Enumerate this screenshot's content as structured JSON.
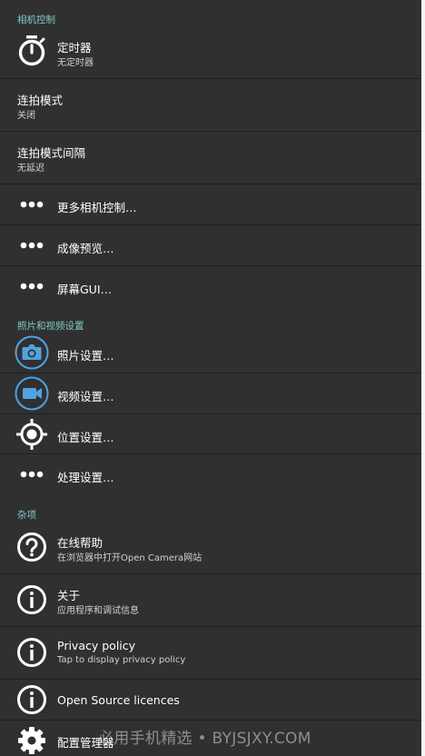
{
  "sections": {
    "camera_controls": "相机控制",
    "photo_video": "照片和视频设置",
    "misc": "杂项"
  },
  "items": {
    "timer": {
      "title": "定时器",
      "subtitle": "无定时器",
      "icon": "timer-icon"
    },
    "burst_mode": {
      "title": "连拍模式",
      "subtitle": "关闭"
    },
    "burst_interval": {
      "title": "连拍模式间隔",
      "subtitle": "无延迟"
    },
    "more_camera": {
      "title": "更多相机控制…",
      "icon": "more-dots-icon"
    },
    "preview": {
      "title": "成像预览…",
      "icon": "more-dots-icon"
    },
    "screen_gui": {
      "title": "屏幕GUI…",
      "icon": "more-dots-icon"
    },
    "photo_settings": {
      "title": "照片设置…",
      "icon": "camera-icon"
    },
    "video_settings": {
      "title": "视频设置…",
      "icon": "videocam-icon"
    },
    "location_settings": {
      "title": "位置设置…",
      "icon": "gps-icon"
    },
    "processing_settings": {
      "title": "处理设置…",
      "icon": "more-dots-icon"
    },
    "online_help": {
      "title": "在线帮助",
      "subtitle": "在浏览器中打开Open Camera网站",
      "icon": "help-icon"
    },
    "about": {
      "title": "关于",
      "subtitle": "应用程序和调试信息",
      "icon": "info-icon"
    },
    "privacy": {
      "title": "Privacy policy",
      "subtitle": "Tap to display privacy policy",
      "icon": "info-icon"
    },
    "licences": {
      "title": "Open Source licences",
      "icon": "info-icon"
    },
    "config_manager": {
      "title": "配置管理器",
      "icon": "gear-icon"
    }
  },
  "watermark": "必用手机精选 • BYJSJXY.COM",
  "colors": {
    "background": "#303030",
    "accent": "#80cbc4",
    "icon_blue": "#4fa3e0"
  }
}
